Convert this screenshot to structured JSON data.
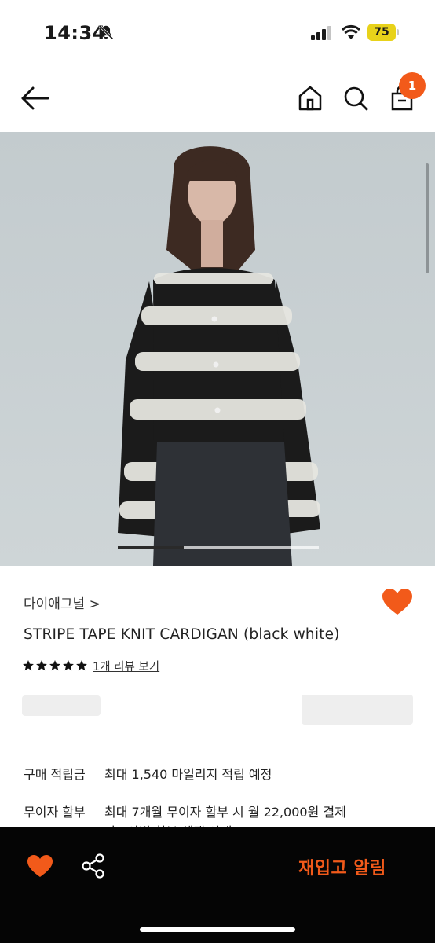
{
  "status_bar": {
    "time": "14:34",
    "battery": "75",
    "icons": [
      "bell-slash-icon",
      "signal-icon",
      "wifi-icon",
      "battery-icon"
    ]
  },
  "nav": {
    "icons": [
      "arrow-left-icon",
      "home-icon",
      "search-icon",
      "bag-icon"
    ],
    "cart_count": "1"
  },
  "product_image": {
    "carousel_progress": 0.33
  },
  "product": {
    "brand": "다이애그널 >",
    "name": "STRIPE TAPE KNIT CARDIGAN (black white)",
    "stars": 5,
    "review_link": "1개 리뷰 보기"
  },
  "details": [
    {
      "label": "구매 적립금",
      "value": "최대 1,540 마일리지 적립 예정"
    },
    {
      "label": "무이자 할부",
      "value": "최대 7개월 무이자 할부 시 월 22,000원 결제"
    },
    {
      "label": "",
      "value": "카드사별 할부 혜택 안내"
    }
  ],
  "bottom_bar": {
    "restock_label": "재입고 알림",
    "icons": [
      "heart-icon",
      "share-icon"
    ]
  },
  "colors": {
    "accent": "#f25a1a",
    "bottom_bar_bg": "#050505",
    "battery": "#e8d21a"
  }
}
